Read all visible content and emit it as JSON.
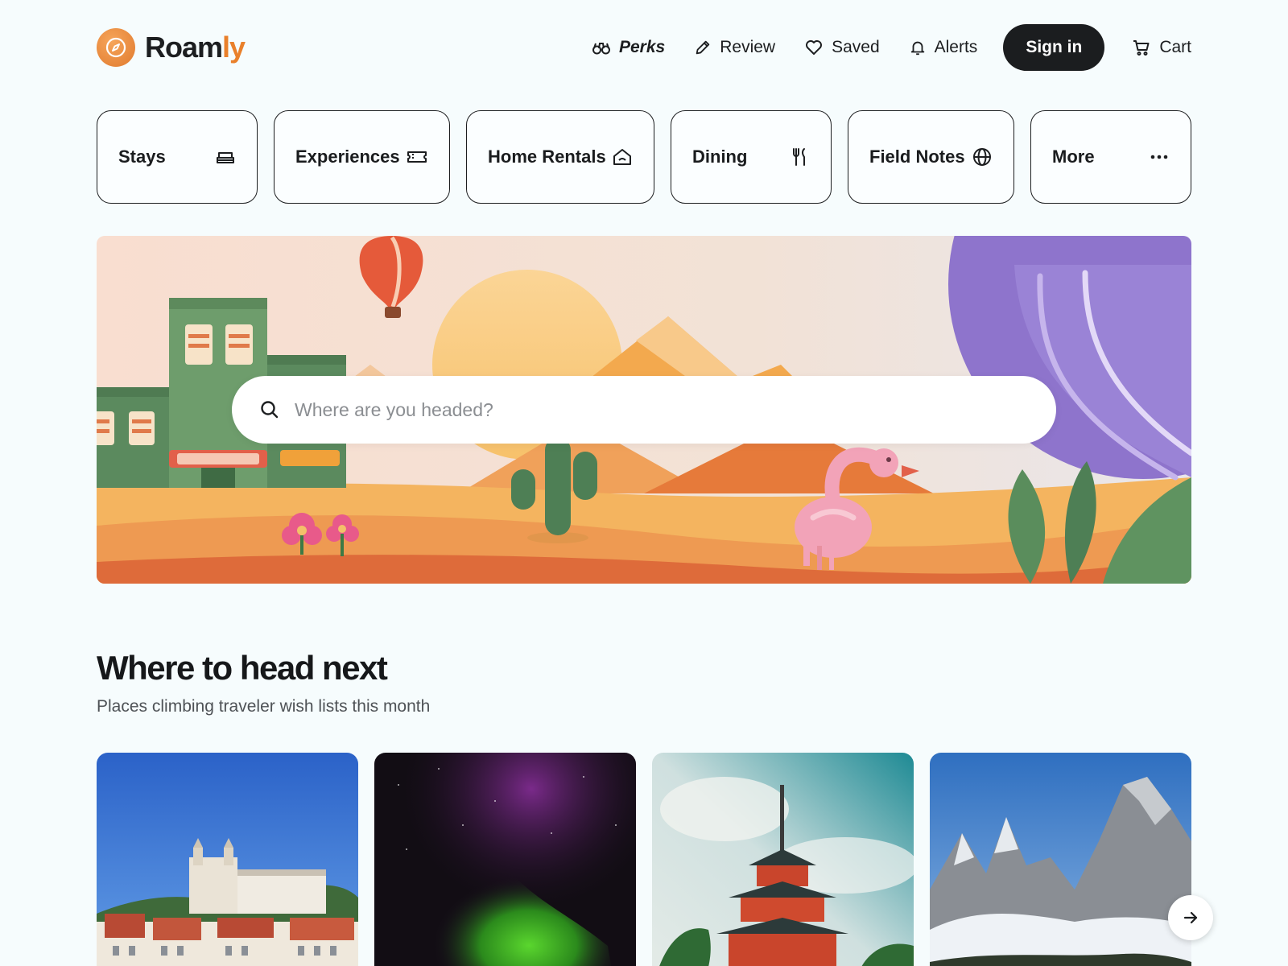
{
  "brand": {
    "name_part1": "Roam",
    "name_part2": "ly",
    "logo_icon": "compass-icon"
  },
  "nav": {
    "items": [
      {
        "label": "Perks",
        "icon": "binoculars-icon"
      },
      {
        "label": "Review",
        "icon": "pencil-icon"
      },
      {
        "label": "Saved",
        "icon": "heart-icon"
      },
      {
        "label": "Alerts",
        "icon": "bell-icon"
      }
    ],
    "signin_label": "Sign in",
    "cart_label": "Cart",
    "cart_icon": "cart-icon"
  },
  "categories": [
    {
      "label": "Stays",
      "icon": "bed-icon"
    },
    {
      "label": "Experiences",
      "icon": "ticket-icon"
    },
    {
      "label": "Home Rentals",
      "icon": "home-icon"
    },
    {
      "label": "Dining",
      "icon": "utensils-icon"
    },
    {
      "label": "Field Notes",
      "icon": "globe-icon"
    },
    {
      "label": "More",
      "icon": "more-dots-icon"
    }
  ],
  "search": {
    "placeholder": "Where are you headed?",
    "value": "",
    "icon": "search-icon"
  },
  "section": {
    "title": "Where to head next",
    "subtitle": "Places climbing traveler wish lists this month"
  },
  "cards": [
    {
      "image": "city-hillside-photo"
    },
    {
      "image": "aurora-photo"
    },
    {
      "image": "pagoda-photo"
    },
    {
      "image": "mountain-peaks-photo"
    }
  ],
  "carousel": {
    "next_icon": "arrow-right-icon"
  },
  "colors": {
    "accent": "#e9802b",
    "dark": "#1b1d1f",
    "background": "#f6fcfd"
  }
}
